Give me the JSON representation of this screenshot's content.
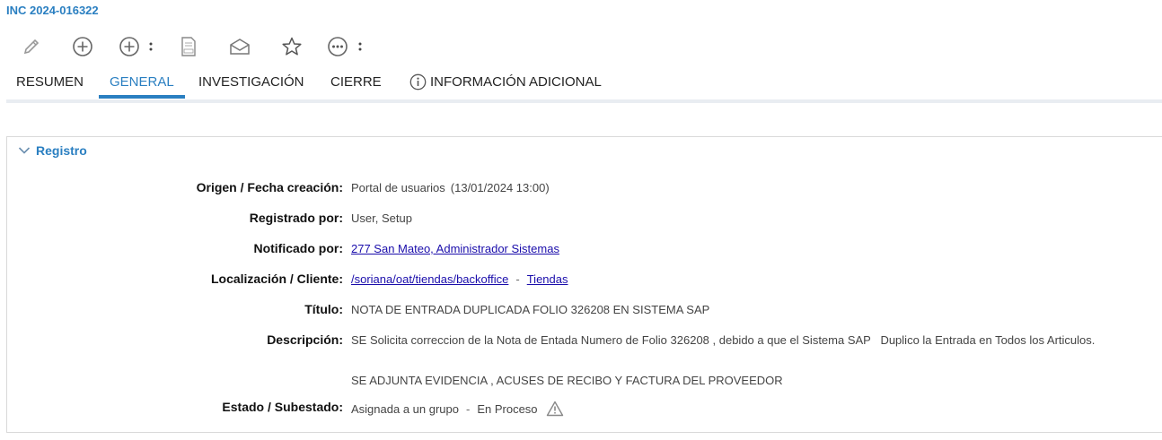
{
  "header": {
    "incident_id": "INC 2024-016322"
  },
  "toolbar": {
    "icons": [
      "pencil-icon",
      "plus-circle-icon",
      "plus-circle-menu-icon",
      "pdf-icon",
      "envelope-icon",
      "star-icon",
      "more-icon"
    ]
  },
  "tabs": [
    {
      "label": "RESUMEN"
    },
    {
      "label": "GENERAL",
      "active": true
    },
    {
      "label": "INVESTIGACIÓN"
    },
    {
      "label": "CIERRE"
    },
    {
      "label": "INFORMACIÓN ADICIONAL"
    }
  ],
  "section": {
    "title": "Registro",
    "fields": {
      "origen": {
        "label": "Origen / Fecha creación:",
        "value": "Portal de usuarios",
        "timestamp": "(13/01/2024 13:00)"
      },
      "registrado": {
        "label": "Registrado por:",
        "value": "User, Setup"
      },
      "notificado": {
        "label": "Notificado por:",
        "value": "277 San Mateo, Administrador Sistemas"
      },
      "localizacion": {
        "label": "Localización / Cliente:",
        "value": "/soriana/oat/tiendas/backoffice",
        "separator": "-",
        "client": "Tiendas"
      },
      "titulo": {
        "label": "Título:",
        "value": "NOTA DE ENTRADA DUPLICADA FOLIO 326208 EN SISTEMA SAP"
      },
      "descripcion": {
        "label": "Descripción:",
        "line1": "SE Solicita correccion de la Nota de Entada Numero de Folio 326208 , debido a que el Sistema SAP   Duplico la Entrada en Todos los Articulos.",
        "line2": "SE ADJUNTA EVIDENCIA , ACUSES DE RECIBO Y FACTURA DEL PROVEEDOR"
      },
      "estado": {
        "label": "Estado / Subestado:",
        "value": "Asignada a un grupo",
        "separator": "-",
        "substate": "En Proceso"
      }
    }
  },
  "colors": {
    "accent": "#2a7fc1",
    "link": "#1a0dab"
  }
}
